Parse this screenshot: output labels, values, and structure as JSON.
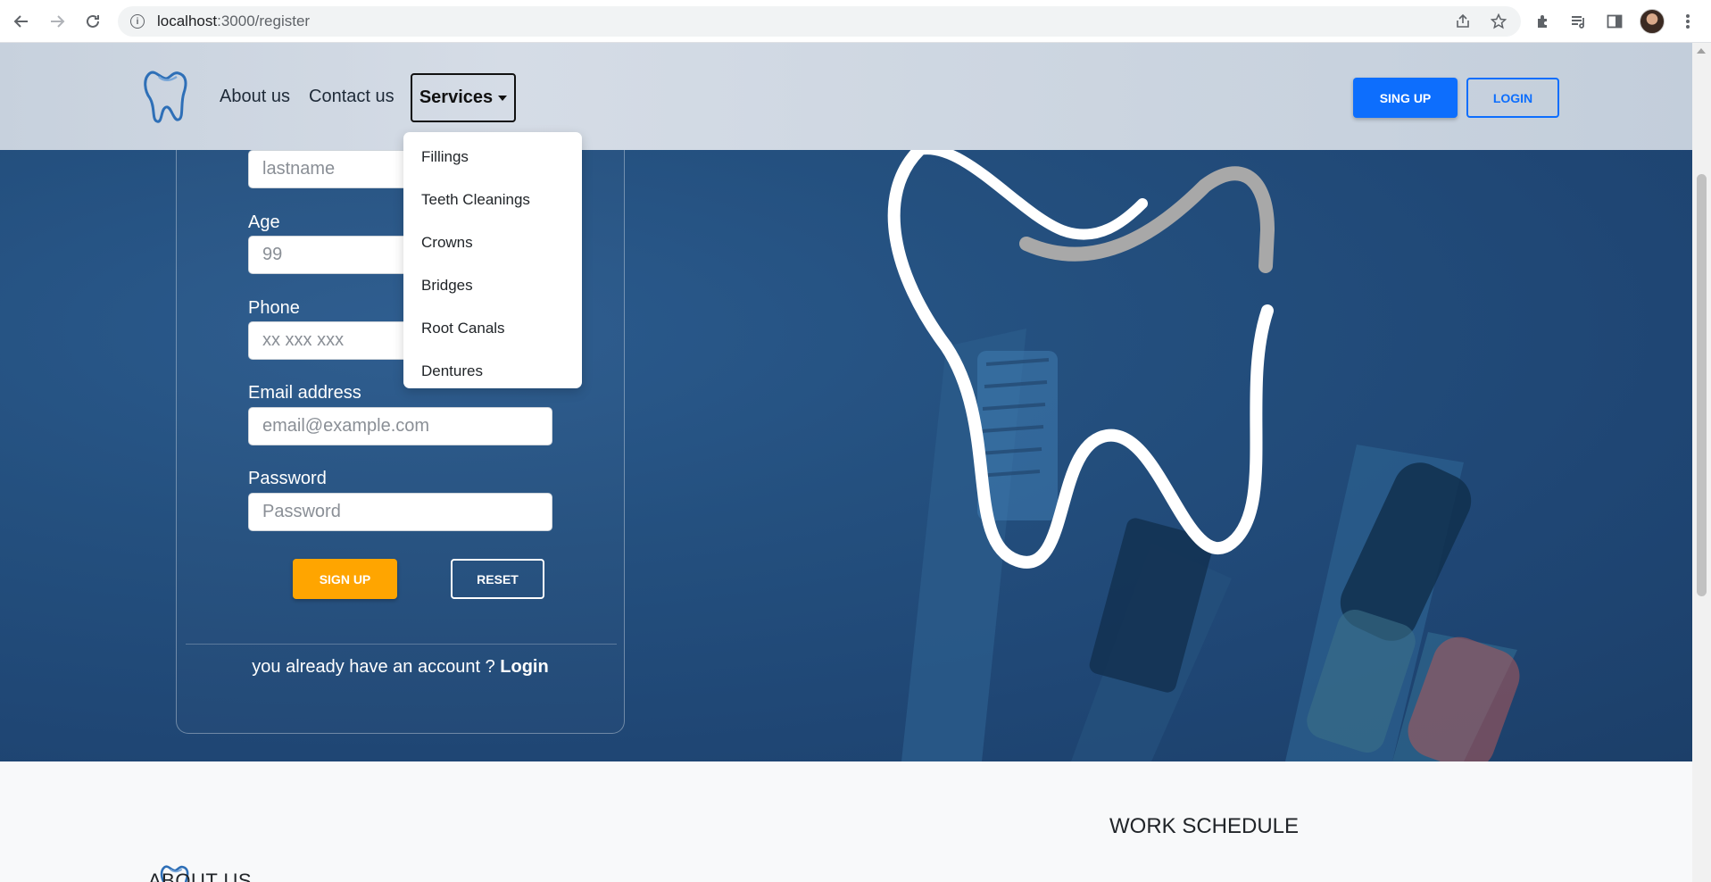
{
  "browser": {
    "url_host": "localhost",
    "url_path": ":3000/register"
  },
  "header": {
    "nav": [
      "About us",
      "Contact us"
    ],
    "services_label": "Services",
    "signup_label": "SING UP",
    "login_label": "LOGIN"
  },
  "services_menu": {
    "items": [
      "Fillings",
      "Teeth Cleanings",
      "Crowns",
      "Bridges",
      "Root Canals",
      "Dentures"
    ]
  },
  "form": {
    "lastname": {
      "placeholder": "lastname"
    },
    "age": {
      "label": "Age",
      "placeholder": "99"
    },
    "phone": {
      "label": "Phone",
      "placeholder": "xx xxx xxx"
    },
    "email": {
      "label": "Email address",
      "placeholder": "email@example.com"
    },
    "password": {
      "label": "Password",
      "placeholder": "Password"
    },
    "signup_label": "SIGN UP",
    "reset_label": "RESET",
    "already_text": "you already have an account ? ",
    "already_link": "Login"
  },
  "footer": {
    "about_title": "ABOUT US",
    "schedule_title": "WORK SCHEDULE"
  },
  "colors": {
    "primary": "#0d6efd",
    "accent": "#ffa500",
    "hero_bg": "#24507f"
  }
}
